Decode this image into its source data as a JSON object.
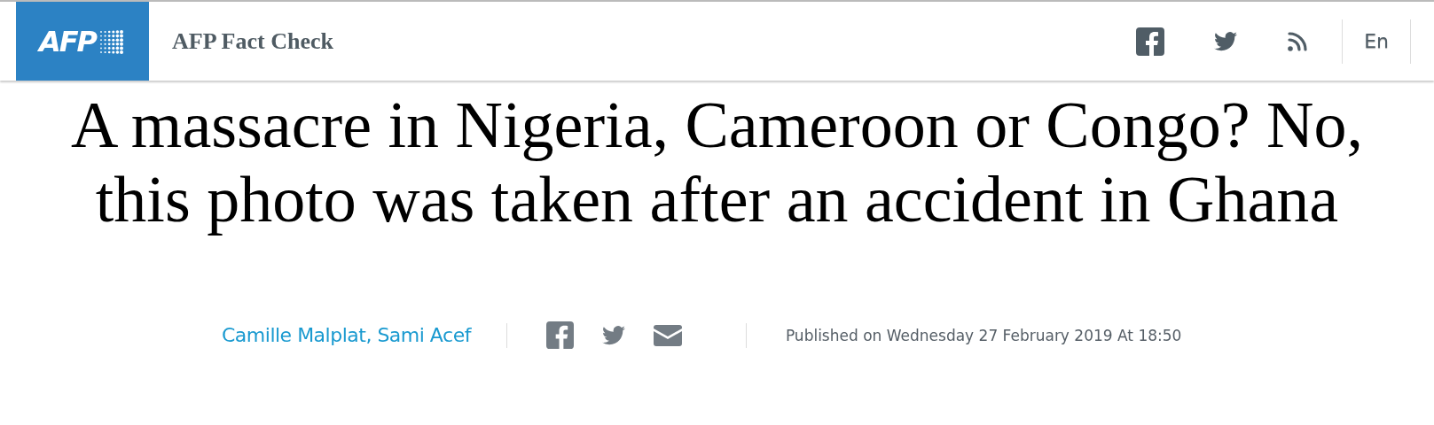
{
  "header": {
    "logo_text": "AFP",
    "site_title": "AFP Fact Check",
    "language": {
      "label": "En",
      "selected": true
    }
  },
  "article": {
    "headline": "A massacre in Nigeria, Cameroon or Congo? No, this photo was taken after an accident in Ghana",
    "authors": "Camille Malplat, Sami Acef",
    "published": "Published on Wednesday 27 February 2019 At 18:50"
  }
}
